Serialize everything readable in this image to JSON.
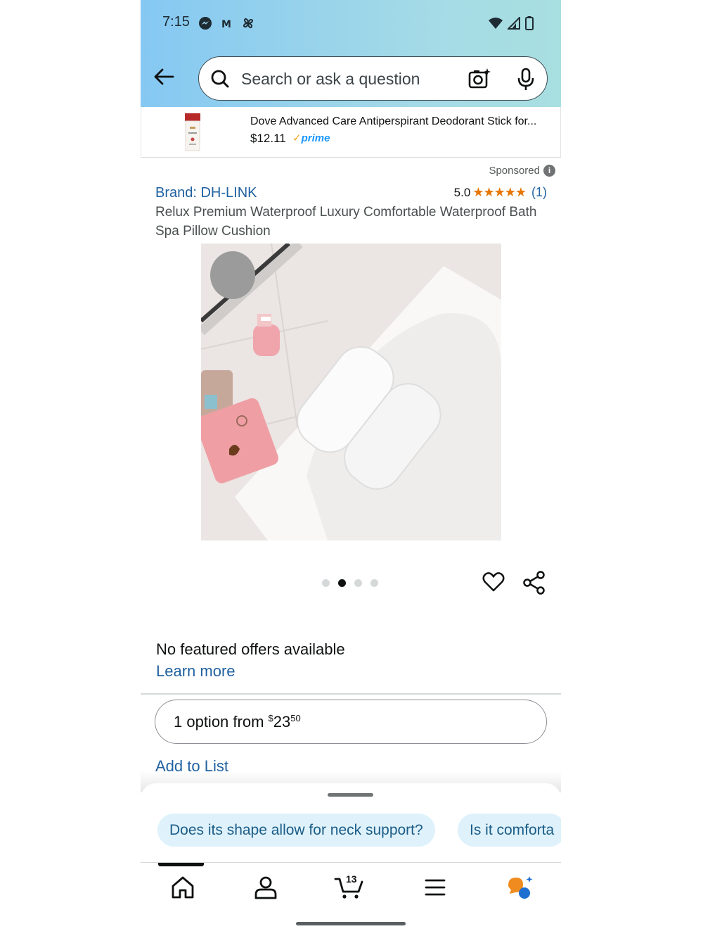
{
  "status_bar": {
    "time": "7:15",
    "left_icons": [
      "messenger-icon",
      "gmail-icon",
      "pinwheel-icon"
    ],
    "right_icons": [
      "wifi-icon",
      "signal-icon",
      "battery-icon"
    ]
  },
  "search": {
    "placeholder": "Search or ask a question",
    "icons": [
      "back-arrow-icon",
      "search-icon",
      "camera-icon",
      "mic-icon"
    ]
  },
  "ad_strip": {
    "title": "Dove Advanced Care Antiperspirant Deodorant Stick for...",
    "price": "$12.11",
    "prime_check": "✓",
    "prime_label": "prime"
  },
  "sponsored": {
    "label": "Sponsored",
    "info": "i"
  },
  "product": {
    "brand": "Brand: DH-LINK",
    "rating_value": "5.0",
    "stars": "★★★★★",
    "rating": 5.0,
    "rating_count": "(1)",
    "title": "Relux Premium Waterproof Luxury Comfortable Waterproof Bath Spa Pillow Cushion",
    "image_count": 4,
    "active_image_index": 1
  },
  "offers": {
    "none_text": "No featured offers available",
    "learn_more": "Learn more",
    "options_prefix": "1 option from ",
    "options_currency": "$",
    "options_whole": "23",
    "options_cents": "50",
    "add_to_list": "Add to List"
  },
  "suggestions": {
    "chips": [
      "Does its shape allow for neck support?",
      "Is it comforta"
    ]
  },
  "bottom_nav": {
    "items": [
      "home-icon",
      "account-icon",
      "cart-icon",
      "menu-icon",
      "rufus-icon"
    ],
    "cart_count": "13"
  },
  "colors": {
    "link": "#2162a1",
    "star": "#e77600",
    "prime": "#1a98ff",
    "chip_bg": "#dff2fb",
    "header_gradient_start": "#85c8f2",
    "header_gradient_end": "#a8dfe0"
  }
}
